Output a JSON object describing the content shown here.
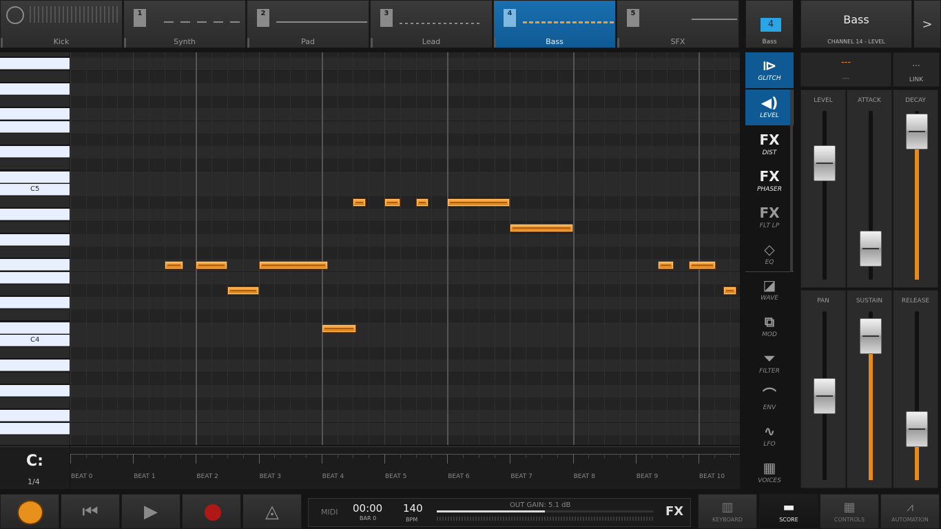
{
  "tracks": [
    {
      "label": "Kick",
      "num": ""
    },
    {
      "label": "Synth",
      "num": "1"
    },
    {
      "label": "Pad",
      "num": "2"
    },
    {
      "label": "Lead",
      "num": "3"
    },
    {
      "label": "Bass",
      "num": "4"
    },
    {
      "label": "SFX",
      "num": "5"
    }
  ],
  "channel": {
    "num": "4",
    "name": "Bass",
    "preset": "Bass",
    "subtitle": "CHANNEL 14 - LEVEL",
    "next": ">"
  },
  "link": {
    "value_a": "---",
    "label_a": "---",
    "value_b": "...",
    "label_b": "LINK"
  },
  "keyboard": {
    "c5": "C5",
    "c4": "C4"
  },
  "quant": {
    "icon": "quantize-icon",
    "value": "1/4"
  },
  "beats": [
    "BEAT 0",
    "BEAT 1",
    "BEAT 2",
    "BEAT 3",
    "BEAT 4",
    "BEAT 5",
    "BEAT 6",
    "BEAT 7",
    "BEAT 8",
    "BEAT 9",
    "BEAT 10"
  ],
  "side_buttons": [
    {
      "label": "GLITCH",
      "icon": "glitch-icon",
      "glyph": "⧐"
    },
    {
      "label": "LEVEL",
      "icon": "speaker-icon",
      "glyph": "◀)"
    },
    {
      "label": "DIST",
      "icon": "fx-icon",
      "glyph": "FX"
    },
    {
      "label": "PHASER",
      "icon": "fx-icon",
      "glyph": "FX"
    },
    {
      "label": "FLT LP",
      "icon": "fx-icon",
      "glyph": "FX"
    },
    {
      "label": "EQ",
      "icon": "eq-icon",
      "glyph": "◇"
    },
    {
      "label": "WAVE",
      "icon": "wave-icon",
      "glyph": "◪"
    },
    {
      "label": "MOD",
      "icon": "mod-icon",
      "glyph": "⧉"
    },
    {
      "label": "FILTER",
      "icon": "filter-icon",
      "glyph": "⏷"
    },
    {
      "label": "ENV",
      "icon": "envelope-icon",
      "glyph": "⌒"
    },
    {
      "label": "LFO",
      "icon": "lfo-icon",
      "glyph": "∿"
    },
    {
      "label": "VOICES",
      "icon": "voices-icon",
      "glyph": "▦"
    }
  ],
  "strips": [
    {
      "title": "LEVEL",
      "level": 0.74
    },
    {
      "title": "ATTACK",
      "level": 0.1
    },
    {
      "title": "DECAY",
      "level": 0.98
    },
    {
      "title": "PAN",
      "level": 0.5
    },
    {
      "title": "SUSTAIN",
      "level": 0.95
    },
    {
      "title": "RELEASE",
      "level": 0.25
    }
  ],
  "transport": {
    "midi": "MIDI",
    "time": "00:00",
    "bar": "BAR 0",
    "bpm": "140",
    "bpm_label": "BPM",
    "gain": "OUT GAIN: 5.1 dB",
    "gain_level": 0.5,
    "fx": "FX"
  },
  "views": [
    {
      "label": "KEYBOARD",
      "icon": "keyboard-icon"
    },
    {
      "label": "SCORE",
      "icon": "score-icon"
    },
    {
      "label": "CONTROLS",
      "icon": "controls-icon"
    },
    {
      "label": "AUTOMATION",
      "icon": "automation-icon"
    }
  ],
  "colors": {
    "accent": "#0f5a94",
    "note": "#f08c1c"
  },
  "notes": [
    {
      "beat": 1.5,
      "len": 0.3,
      "key": 5
    },
    {
      "beat": 2.0,
      "len": 0.5,
      "key": 5
    },
    {
      "beat": 2.5,
      "len": 0.5,
      "key": 3
    },
    {
      "beat": 3.0,
      "len": 1.1,
      "key": 5
    },
    {
      "beat": 4.0,
      "len": 0.55,
      "key": 0
    },
    {
      "beat": 4.5,
      "len": 0.2,
      "key": 10
    },
    {
      "beat": 5.0,
      "len": 0.25,
      "key": 10
    },
    {
      "beat": 5.5,
      "len": 0.2,
      "key": 10
    },
    {
      "beat": 6.0,
      "len": 1.0,
      "key": 10
    },
    {
      "beat": 7.0,
      "len": 1.0,
      "key": 8
    },
    {
      "beat": 9.35,
      "len": 0.25,
      "key": 5
    },
    {
      "beat": 9.85,
      "len": 0.42,
      "key": 5
    },
    {
      "beat": 10.4,
      "len": 0.2,
      "key": 3
    }
  ]
}
